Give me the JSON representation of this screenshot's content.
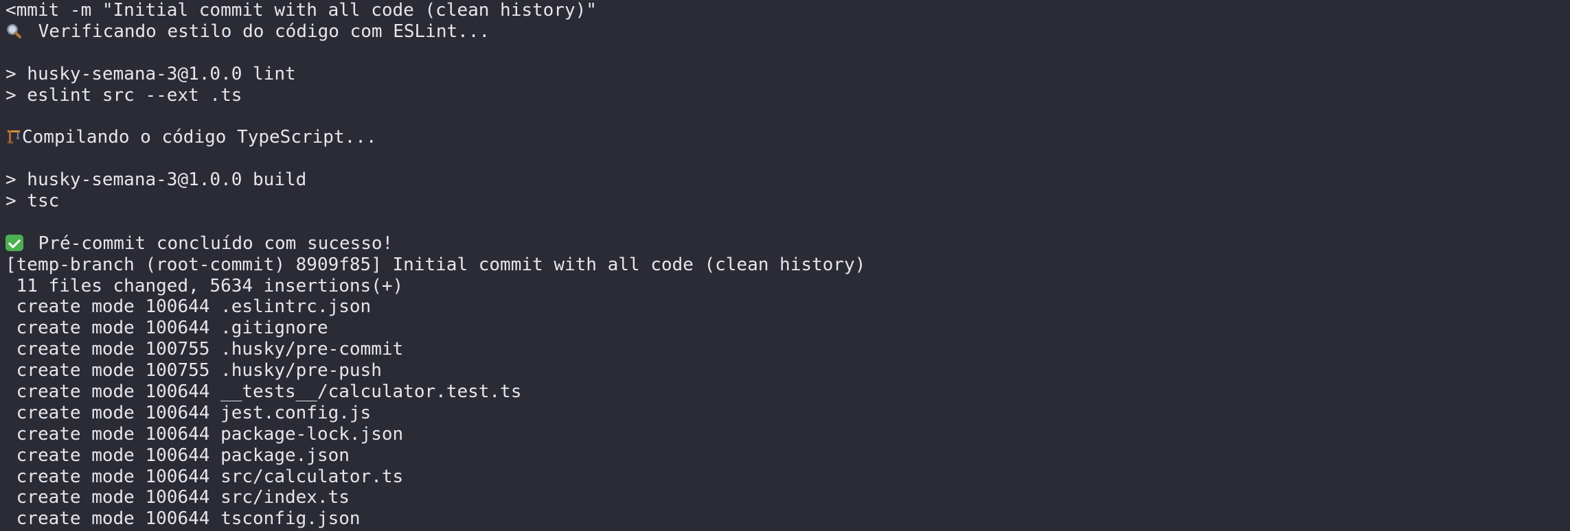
{
  "terminal": {
    "lines": [
      {
        "text": "<mmit -m \"Initial commit with all code (clean history)\""
      },
      {
        "icon": "magnifier-icon",
        "text": " Verificando estilo do código com ESLint..."
      },
      {
        "text": ""
      },
      {
        "text": "> husky-semana-3@1.0.0 lint"
      },
      {
        "text": "> eslint src --ext .ts"
      },
      {
        "text": ""
      },
      {
        "icon": "construction-crane-icon",
        "text": "Compilando o código TypeScript..."
      },
      {
        "text": ""
      },
      {
        "text": "> husky-semana-3@1.0.0 build"
      },
      {
        "text": "> tsc"
      },
      {
        "text": ""
      },
      {
        "icon": "checkmark-icon",
        "text": " Pré-commit concluído com sucesso!"
      },
      {
        "text": "[temp-branch (root-commit) 8909f85] Initial commit with all code (clean history)"
      },
      {
        "text": " 11 files changed, 5634 insertions(+)"
      },
      {
        "text": " create mode 100644 .eslintrc.json"
      },
      {
        "text": " create mode 100644 .gitignore"
      },
      {
        "text": " create mode 100755 .husky/pre-commit"
      },
      {
        "text": " create mode 100755 .husky/pre-push"
      },
      {
        "text": " create mode 100644 __tests__/calculator.test.ts"
      },
      {
        "text": " create mode 100644 jest.config.js"
      },
      {
        "text": " create mode 100644 package-lock.json"
      },
      {
        "text": " create mode 100644 package.json"
      },
      {
        "text": " create mode 100644 src/calculator.ts"
      },
      {
        "text": " create mode 100644 src/index.ts"
      },
      {
        "text": " create mode 100644 tsconfig.json"
      }
    ]
  },
  "colors": {
    "background": "#2b2b36",
    "foreground": "#e6e6ea",
    "check": "#4caf50"
  }
}
